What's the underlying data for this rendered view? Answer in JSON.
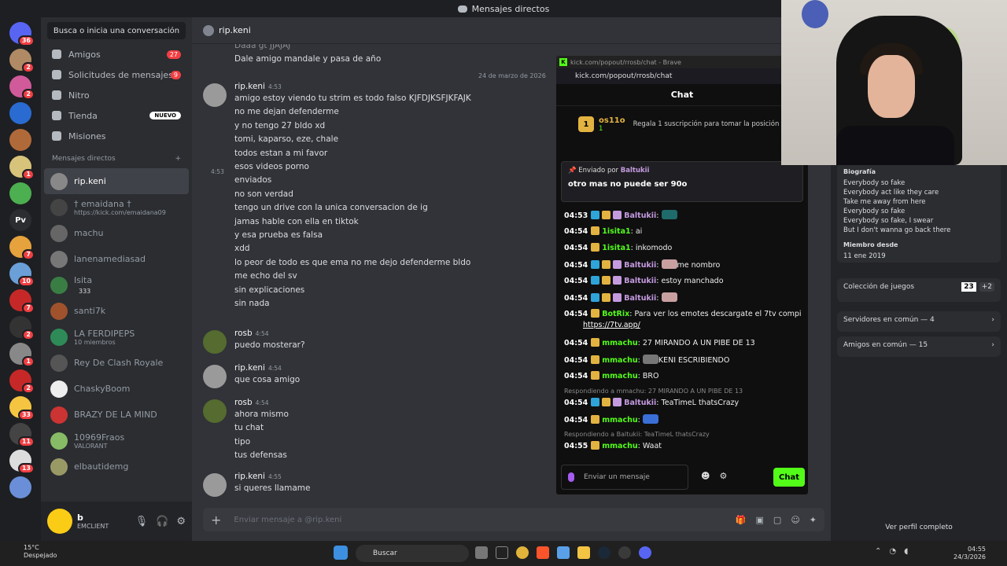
{
  "window": {
    "title": "Mensajes directos"
  },
  "sidebar": {
    "search": "Busca o inicia una conversación",
    "nav": [
      {
        "label": "Amigos",
        "count": "27"
      },
      {
        "label": "Solicitudes de mensajes",
        "count": "9"
      },
      {
        "label": "Nitro"
      },
      {
        "label": "Tienda",
        "badge": "NUEVO"
      },
      {
        "label": "Misiones"
      }
    ],
    "dm_header": "Mensajes directos",
    "dms": [
      {
        "name": "rip.keni",
        "sub": "",
        "color": "#888"
      },
      {
        "name": "† emaidana †",
        "sub": "https://kick.com/emaidana09",
        "color": "#444"
      },
      {
        "name": "machu",
        "sub": "",
        "color": "#666"
      },
      {
        "name": "lanenamediasad",
        "sub": "",
        "color": "#777"
      },
      {
        "name": "Isita",
        "sub": "",
        "extra": "333",
        "color": "#3a7d44"
      },
      {
        "name": "santi7k",
        "sub": "",
        "color": "#a0522d"
      },
      {
        "name": "LA FERDIPEPS",
        "sub": "10 miembros",
        "color": "#2e8b57"
      },
      {
        "name": "Rey De Clash Royale",
        "sub": "",
        "color": "#555"
      },
      {
        "name": "ChaskyBoom",
        "sub": "",
        "color": "#eee"
      },
      {
        "name": "BRAZY DE LA MIND",
        "sub": "",
        "color": "#c33"
      },
      {
        "name": "10969Fraos",
        "sub": "VALORANT",
        "color": "#8b6"
      },
      {
        "name": "elbautidemg",
        "sub": "",
        "color": "#996"
      }
    ]
  },
  "guilds": [
    {
      "label": "",
      "badge": "36",
      "color": "#5865f2"
    },
    {
      "label": "",
      "badge": "2",
      "color": "#b08a64"
    },
    {
      "label": "",
      "badge": "2",
      "color": "#d05a9a"
    },
    {
      "label": "",
      "badge": "",
      "color": "#2a6bd1"
    },
    {
      "label": "",
      "badge": "",
      "color": "#b06a3a"
    },
    {
      "label": "",
      "badge": "1",
      "color": "#d8c37a"
    },
    {
      "label": "",
      "badge": "",
      "color": "#4caf50"
    },
    {
      "label": "Pv",
      "badge": "",
      "color": "#2b2d31"
    },
    {
      "label": "",
      "badge": "7",
      "color": "#e6a23c"
    },
    {
      "label": "",
      "badge": "10",
      "color": "#6a9fd8"
    },
    {
      "label": "",
      "badge": "7",
      "color": "#c62828"
    },
    {
      "label": "",
      "badge": "2",
      "color": "#333"
    },
    {
      "label": "",
      "badge": "1",
      "color": "#888"
    },
    {
      "label": "",
      "badge": "2",
      "color": "#c62828"
    },
    {
      "label": "",
      "badge": "33",
      "color": "#f5c542"
    },
    {
      "label": "",
      "badge": "11",
      "color": "#444"
    },
    {
      "label": "",
      "badge": "13",
      "color": "#ddd"
    },
    {
      "label": "",
      "badge": "",
      "color": "#6a8fd8"
    }
  ],
  "user": {
    "name": "b",
    "status": "EMCLIENT"
  },
  "channel": {
    "name": "rip.keni",
    "composer_placeholder": "Enviar mensaje a @rip.keni"
  },
  "chat": {
    "date_separator": "24 de marzo de 2026",
    "hover_time": "4:53",
    "top_lines": [
      "Daaa gt JJAJAJ",
      "Dale amigo mandale y pasa de año"
    ],
    "groups": [
      {
        "author": "rip.keni",
        "time": "4:53",
        "lines": [
          "amigo estoy viendo tu strim es todo falso KJFDJKSFJKFAJK",
          "no me dejan defenderme",
          "y no tengo 27 bldo xd",
          "tomi, kaparso, eze, chale",
          "todos estan a mi favor",
          "esos videos porno",
          "enviados",
          "no son verdad",
          "tengo un drive con la unica conversacion de ig",
          "jamas hable con ella en tiktok",
          "y esa prueba es falsa",
          "xdd",
          "lo peor de todo es que ema no me dejo defenderme bldo",
          "me echo del sv",
          "sin explicaciones",
          "sin nada"
        ]
      },
      {
        "author": "rosb",
        "time": "4:54",
        "lines": [
          "puedo mosterar?"
        ]
      },
      {
        "author": "rip.keni",
        "time": "4:54",
        "lines": [
          "que cosa amigo"
        ]
      },
      {
        "author": "rosb",
        "time": "4:54",
        "lines": [
          "ahora mismo",
          "tu chat",
          "tipo",
          "tus defensas"
        ]
      },
      {
        "author": "rip.keni",
        "time": "4:55",
        "lines": [
          "si queres llamame"
        ]
      }
    ]
  },
  "profile": {
    "bio_label": "Biografía",
    "bio": [
      "Everybody so fake",
      "Everybody act like they care",
      "Take me away from here",
      "Everybody so fake",
      "Everybody so fake, I swear",
      "But I don't wanna go back there"
    ],
    "member_label": "Miembro desde",
    "member_since": "11 ene 2019",
    "games_label": "Colección de juegos",
    "games_count": "23",
    "games_more": "+2",
    "servers": "Servidores en común — 4",
    "friends": "Amigos en común — 15",
    "full_profile": "Ver perfil completo"
  },
  "kick": {
    "window_title": "kick.com/popout/rrosb/chat - Brave",
    "url": "kick.com/popout/rrosb/chat",
    "title": "Chat",
    "leader_rank": "1",
    "leader_name": "os11o",
    "leader_count": "1",
    "leader_cta": "Regala 1 suscripción para tomar la posición",
    "pinned_by": "Enviado por",
    "pinned_user": "Baltukii",
    "pinned_text": "otro mas no puede ser 90o",
    "messages": [
      {
        "time": "04:53",
        "user": "Baltukii",
        "text": "",
        "style": "purple"
      },
      {
        "time": "04:54",
        "user": "1isita1",
        "text": "ai",
        "style": "green"
      },
      {
        "time": "04:54",
        "user": "1isita1",
        "text": "inkomodo",
        "style": "green"
      },
      {
        "time": "04:54",
        "user": "Baltukii",
        "text": "me nombro",
        "style": "purple"
      },
      {
        "time": "04:54",
        "user": "Baltukii",
        "text": "estoy manchado",
        "style": "purple"
      },
      {
        "time": "04:54",
        "user": "Baltukii",
        "text": "",
        "style": "purple"
      },
      {
        "time": "04:54",
        "user": "BotRix",
        "text": "Para ver los emotes descargate el 7tv compi",
        "style": "green"
      },
      {
        "time": "04:54",
        "user": "mmachu",
        "text": "27 MIRANDO A UN PIBE DE 13",
        "style": "green"
      },
      {
        "time": "04:54",
        "user": "mmachu",
        "text": "KENI ESCRIBIENDO",
        "style": "green"
      },
      {
        "time": "04:54",
        "user": "mmachu",
        "text": "BRO",
        "style": "green"
      },
      {
        "time": "04:54",
        "user": "Baltukii",
        "text": "TeaTimeL thatsCrazy",
        "style": "purple"
      },
      {
        "time": "04:54",
        "user": "mmachu",
        "text": "",
        "style": "green"
      },
      {
        "time": "04:55",
        "user": "mmachu",
        "text": "Waat",
        "style": "green"
      }
    ],
    "link": "https://7tv.app/",
    "reply1": "Respondiendo a mmachu: 27 MIRANDO A UN PIBE DE 13",
    "reply2": "Respondiendo a Baltukii: TeaTimeL thatsCrazy",
    "input_placeholder": "Enviar un mensaje",
    "send": "Chat"
  },
  "taskbar": {
    "search": "Buscar",
    "weather_temp": "15°C",
    "weather_desc": "Despejado",
    "time": "04:55",
    "date": "24/3/2026"
  },
  "colors": {
    "accent": "#5865f2",
    "kick_green": "#53fc18",
    "danger": "#f23f43"
  }
}
